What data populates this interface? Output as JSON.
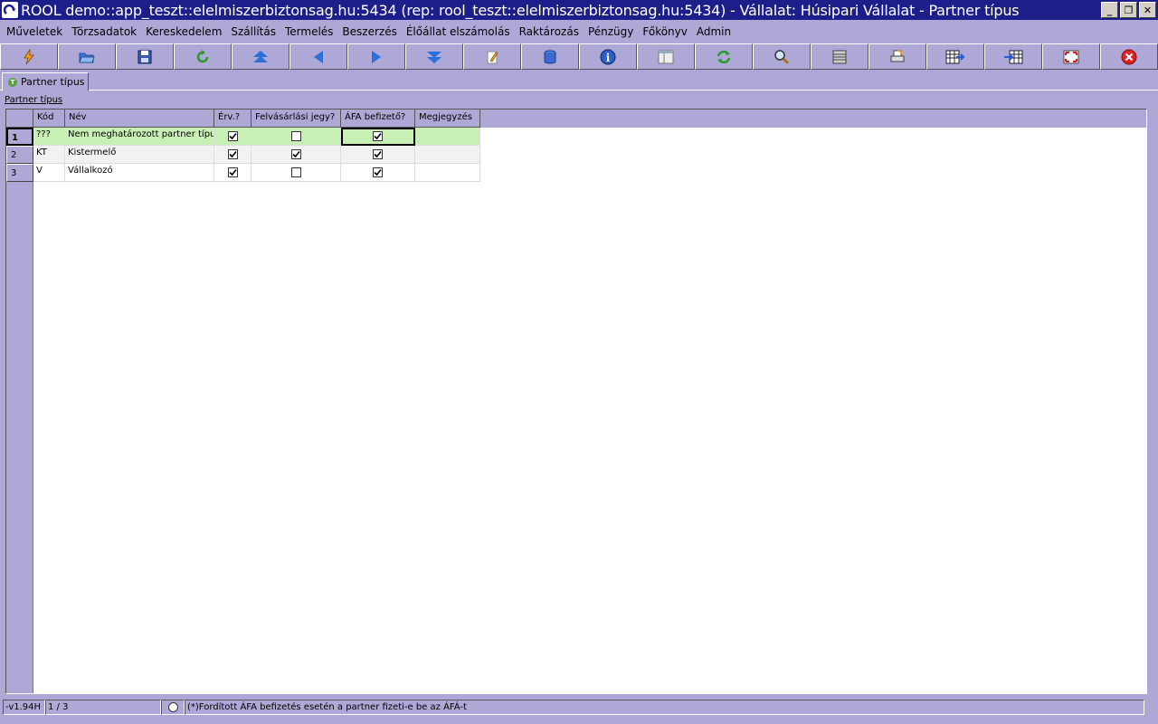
{
  "window": {
    "title": "ROOL demo::app_teszt::elelmiszerbiztonsag.hu:5434 (rep: rool_teszt::elelmiszerbiztonsag.hu:5434) - Vállalat: Húsipari Vállalat - Partner típus",
    "minimize": "_",
    "restore": "❐",
    "close": "✕"
  },
  "menu": [
    "Műveletek",
    "Törzsadatok",
    "Kereskedelem",
    "Szállítás",
    "Termelés",
    "Beszerzés",
    "Élőállat elszámolás",
    "Raktározás",
    "Pénzügy",
    "Főkönyv",
    "Admin"
  ],
  "toolbar": {
    "icons": [
      "lightning-icon",
      "open-folder-icon",
      "save-disk-icon",
      "refresh-arrow-icon",
      "first-record-icon",
      "previous-record-icon",
      "next-record-icon",
      "last-record-icon",
      "edit-pencil-icon",
      "database-icon",
      "info-icon",
      "layout-icon",
      "reload-icon",
      "search-icon",
      "columns-icon",
      "print-icon",
      "export-grid-icon",
      "import-grid-icon",
      "fullscreen-icon",
      "close-icon"
    ]
  },
  "tab": {
    "label": "Partner típus",
    "icon_letter": "T"
  },
  "section_label": "Partner típus",
  "grid": {
    "columns": [
      "Kód",
      "Név",
      "Érv.?",
      "Felvásárlási jegy?",
      "ÁFA befizető?",
      "Megjegyzés"
    ],
    "rows": [
      {
        "num": "1",
        "kod": "???",
        "nev": "Nem meghatározott partner típus",
        "erv": true,
        "felv": false,
        "afa": true,
        "megj": ""
      },
      {
        "num": "2",
        "kod": "KT",
        "nev": "Kistermelő",
        "erv": true,
        "felv": true,
        "afa": true,
        "megj": ""
      },
      {
        "num": "3",
        "kod": "V",
        "nev": "Vállalkozó",
        "erv": true,
        "felv": false,
        "afa": true,
        "megj": ""
      }
    ]
  },
  "status": {
    "version": "-v1.94H",
    "position": "1 / 3",
    "hint": "(*)Fordított ÁFA befizetés esetén a partner fizeti-e be az ÁFÁ-t"
  },
  "colors": {
    "background": "#ada8d6",
    "titlebar": "#1e1e8a",
    "selected_row": "#c8f0b4"
  }
}
